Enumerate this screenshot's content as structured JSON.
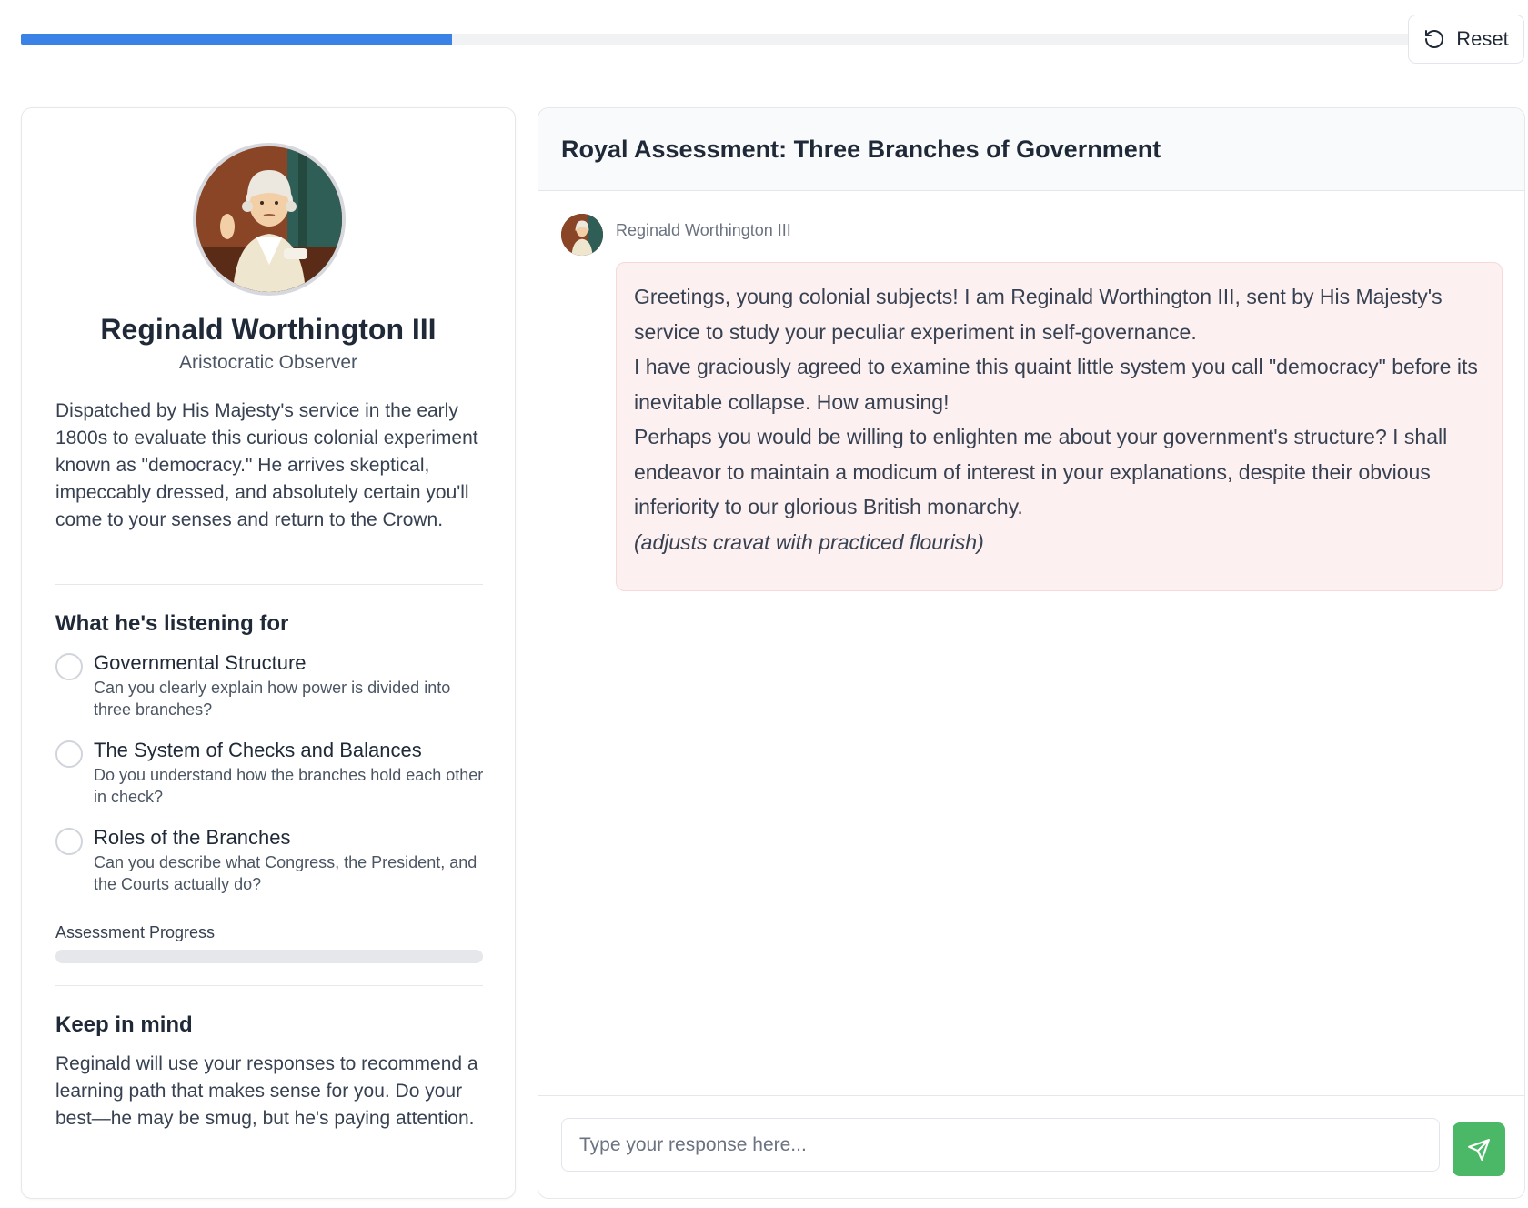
{
  "top_progress": {
    "fraction": 0.31
  },
  "reset_label": "Reset",
  "persona": {
    "name": "Reginald Worthington III",
    "role": "Aristocratic Observer",
    "description": "Dispatched by His Majesty's service in the early 1800s to evaluate this curious colonial experiment known as \"democracy.\" He arrives skeptical, impeccably dressed, and absolutely certain you'll come to your senses and return to the Crown."
  },
  "criteria_heading": "What he's listening for",
  "criteria": [
    {
      "title": "Governmental Structure",
      "description": "Can you clearly explain how power is divided into three branches?",
      "checked": false
    },
    {
      "title": "The System of Checks and Balances",
      "description": "Do you understand how the branches hold each other in check?",
      "checked": false
    },
    {
      "title": "Roles of the Branches",
      "description": "Can you describe what Congress, the President, and the Courts actually do?",
      "checked": false
    }
  ],
  "assessment": {
    "label": "Assessment Progress",
    "fraction": 0
  },
  "keep_in_mind": {
    "heading": "Keep in mind",
    "text": "Reginald will use your responses to recommend a learning path that makes sense for you. Do your best—he may be smug, but he's paying attention."
  },
  "chat": {
    "title": "Royal Assessment: Three Branches of Government",
    "message": {
      "sender": "Reginald Worthington III",
      "paragraphs": [
        "Greetings, young colonial subjects! I am Reginald Worthington III, sent by His Majesty's service to study your peculiar experiment in self-governance.",
        "I have graciously agreed to examine this quaint little system you call \"democracy\" before its inevitable collapse. How amusing!",
        "Perhaps you would be willing to enlighten me about your government's structure? I shall endeavor to maintain a modicum of interest in your explanations, despite their obvious inferiority to our glorious British monarchy."
      ],
      "stage_direction": "(adjusts cravat with practiced flourish)"
    },
    "input": {
      "placeholder": "Type your response here...",
      "value": ""
    },
    "send_icon": "paper-plane-icon"
  },
  "colors": {
    "accent_blue": "#3b82e6",
    "send_green": "#4ab866",
    "bubble_bg": "#fcf0f0"
  }
}
